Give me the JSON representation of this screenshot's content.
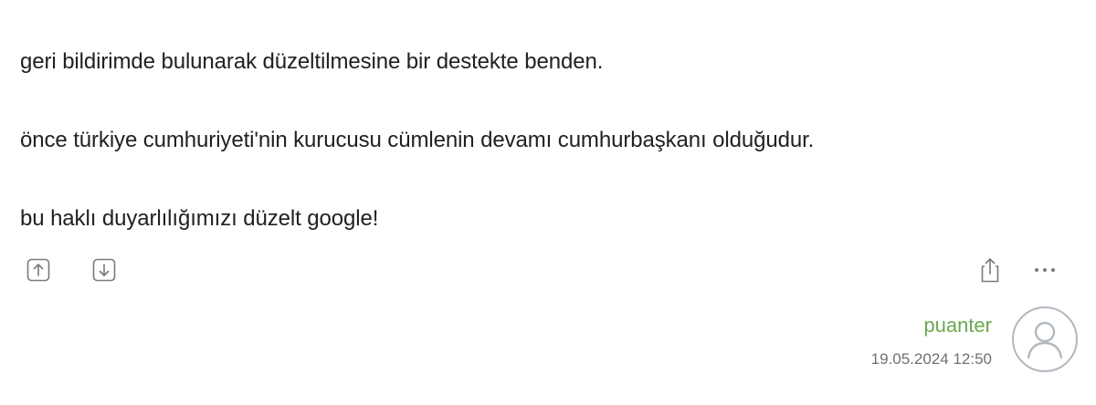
{
  "entry": {
    "paragraphs": [
      "geri bildirimde bulunarak düzeltilmesine bir destekte benden.",
      "önce türkiye cumhuriyeti'nin kurucusu cümlenin devamı cumhurbaşkanı olduğudur.",
      "bu haklı duyarlılığımızı düzelt google!"
    ]
  },
  "actions": {
    "upvote_icon": "arrow-up-box-icon",
    "downvote_icon": "arrow-down-box-icon",
    "share_icon": "share-icon",
    "more_icon": "more-horizontal-icon",
    "more_label": "..."
  },
  "author": {
    "username": "puanter",
    "date": "19.05.2024 12:50",
    "avatar_icon": "user-avatar-icon"
  },
  "colors": {
    "text": "#212121",
    "author": "#6aa84f",
    "meta": "#707070",
    "icon": "#7a7a7a"
  }
}
